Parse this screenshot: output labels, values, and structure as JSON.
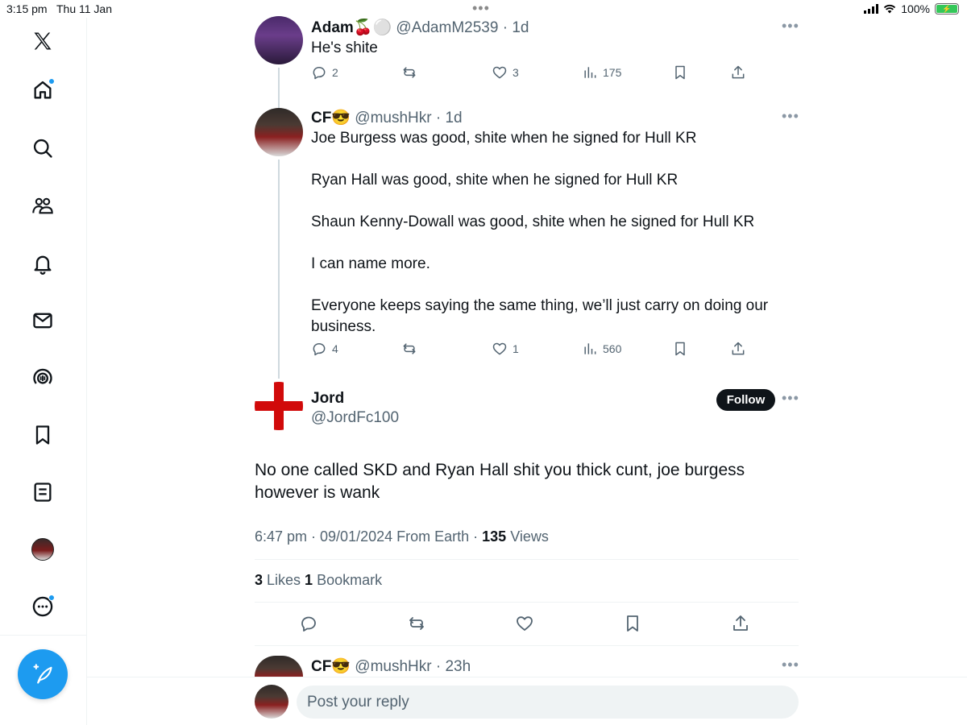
{
  "status_bar": {
    "time": "3:15 pm",
    "date": "Thu 11 Jan",
    "battery": "100%"
  },
  "sidebar": {
    "items": [
      {
        "name": "x-logo",
        "icon": "x-logo-icon"
      },
      {
        "name": "home",
        "icon": "home-icon",
        "badge": true
      },
      {
        "name": "explore",
        "icon": "search-icon"
      },
      {
        "name": "communities",
        "icon": "communities-icon"
      },
      {
        "name": "notifications",
        "icon": "bell-icon"
      },
      {
        "name": "messages",
        "icon": "mail-icon"
      },
      {
        "name": "spaces",
        "icon": "spaces-icon"
      },
      {
        "name": "bookmarks",
        "icon": "bookmark-icon"
      },
      {
        "name": "lists",
        "icon": "list-icon"
      },
      {
        "name": "profile",
        "icon": "avatar"
      },
      {
        "name": "more",
        "icon": "more-circle-icon",
        "badge": true
      }
    ],
    "compose_icon": "compose-feather-icon"
  },
  "thread": [
    {
      "name": "Adam",
      "emoji": "🍒⚪",
      "handle": "@AdamM2539",
      "time": "1d",
      "text": "He's shite",
      "replies": "2",
      "retweets": "",
      "likes": "3",
      "views": "175"
    },
    {
      "name": "CF",
      "emoji": "😎",
      "handle": "@mushHkr",
      "time": "1d",
      "paragraphs": [
        "Joe Burgess was good, shite when he signed for Hull KR",
        "Ryan Hall was good, shite when he signed for Hull KR",
        "Shaun Kenny-Dowall was good, shite when he signed for Hull KR",
        "I can name more.",
        "Everyone keeps saying the same thing, we’ll just carry on doing our business."
      ],
      "replies": "4",
      "retweets": "",
      "likes": "1",
      "views": "560"
    }
  ],
  "focused": {
    "name": "Jord",
    "handle": "@JordFc100",
    "follow_label": "Follow",
    "text": "No one called SKD and Ryan Hall shit you thick cunt, joe burgess however is wank",
    "timestamp": "6:47 pm · 09/01/2024 From Earth · ",
    "views_count": "135",
    "views_label": " Views",
    "likes_count": "3",
    "likes_label": " Likes ",
    "bookmark_count": "1",
    "bookmark_label": " Bookmark"
  },
  "next_reply": {
    "name": "CF",
    "emoji": "😎",
    "handle": "@mushHkr",
    "time": "23h"
  },
  "reply_bar": {
    "placeholder": "Post your reply"
  },
  "colors": {
    "accent": "#1d9bf0",
    "text": "#0f1419",
    "secondary": "#536471",
    "flag_red": "#d10a0a"
  }
}
